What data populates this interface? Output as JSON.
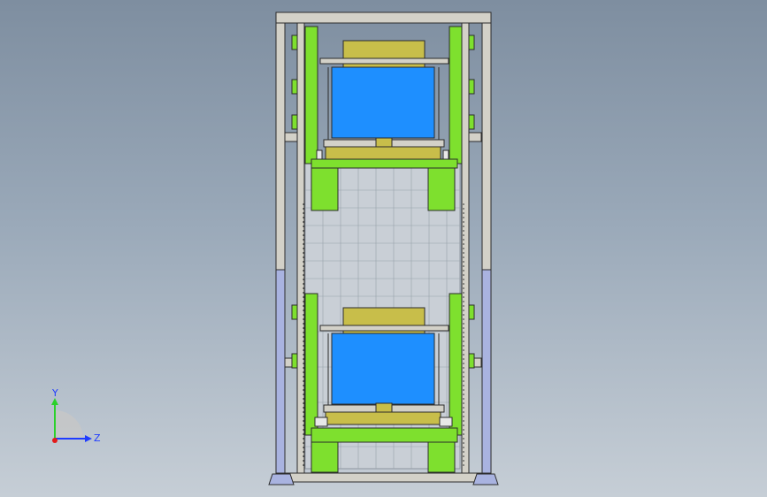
{
  "viewport": {
    "background_top": "#7e8ea0",
    "background_bottom": "#c6ced6"
  },
  "model": {
    "colors": {
      "frame": "#d3d1c8",
      "frame_edge": "#2b2b2b",
      "lower_panel": "#a9b3e0",
      "guide": "#7ee02e",
      "container": "#1e8fff",
      "lid": "#c8be4a",
      "mesh": "#c9cfd6",
      "mesh_line": "#8d969f"
    }
  },
  "triad": {
    "y_label": "Y",
    "z_label": "Z",
    "y_color": "#2bd12b",
    "z_color": "#1f3cff",
    "x_color": "#e21b1b"
  }
}
